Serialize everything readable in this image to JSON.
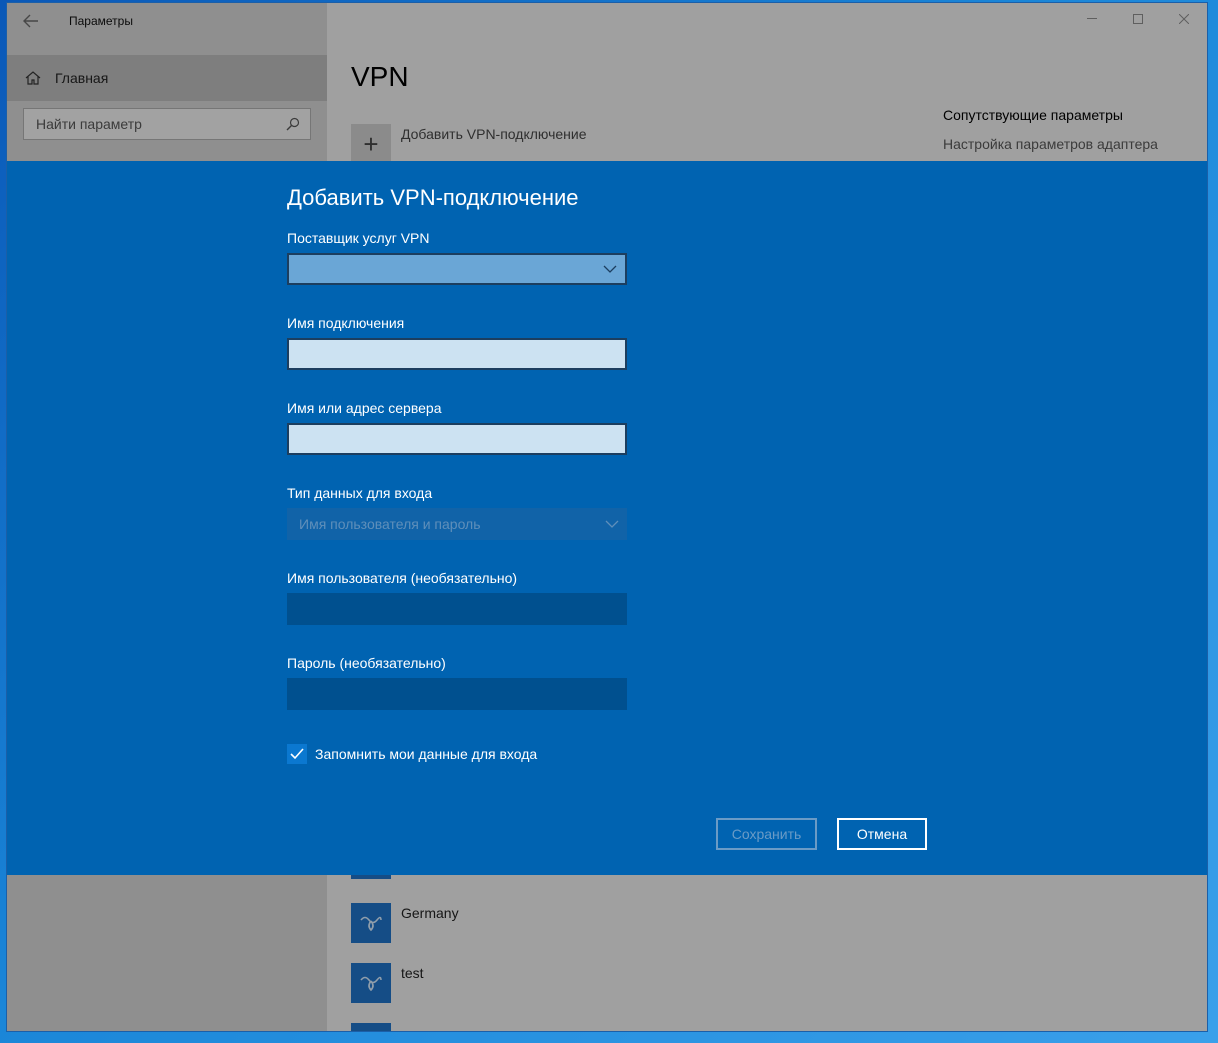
{
  "window": {
    "title": "Параметры",
    "back_icon": "back-arrow-icon",
    "caption_buttons": [
      "minimize-icon",
      "maximize-icon",
      "close-icon"
    ]
  },
  "sidebar": {
    "home_label": "Главная",
    "home_icon": "home-icon",
    "search_placeholder": "Найти параметр",
    "search_icon": "search-icon"
  },
  "main": {
    "page_title": "VPN",
    "add_vpn_label": "Добавить VPN-подключение",
    "related": {
      "title": "Сопутствующие параметры",
      "adapter_link": "Настройка параметров адаптера"
    },
    "vpn_connections": [
      "Germany",
      "test"
    ]
  },
  "dialog": {
    "title": "Добавить VPN-подключение",
    "provider_label": "Поставщик услуг VPN",
    "provider_value": "",
    "connection_name_label": "Имя подключения",
    "connection_name_value": "",
    "server_label": "Имя или адрес сервера",
    "server_value": "",
    "signin_type_label": "Тип данных для входа",
    "signin_type_value": "Имя пользователя и пароль",
    "username_label": "Имя пользователя (необязательно)",
    "password_label": "Пароль (необязательно)",
    "remember_label": "Запомнить мои данные для входа",
    "remember_checked": true,
    "save_label": "Сохранить",
    "cancel_label": "Отмена"
  },
  "colors": {
    "dialog_bg": "#0063b1",
    "accent": "#0078d7"
  }
}
